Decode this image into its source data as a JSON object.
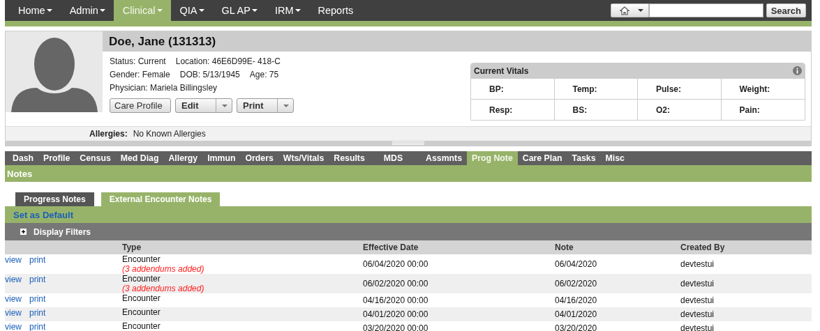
{
  "top_menu": [
    {
      "label": "Home",
      "dropdown": true,
      "selected": false
    },
    {
      "label": "Admin",
      "dropdown": true,
      "selected": false
    },
    {
      "label": "Clinical",
      "dropdown": true,
      "selected": true
    },
    {
      "label": "QIA",
      "dropdown": true,
      "selected": false
    },
    {
      "label": "GL AP",
      "dropdown": true,
      "selected": false
    },
    {
      "label": "IRM",
      "dropdown": true,
      "selected": false
    },
    {
      "label": "Reports",
      "dropdown": false,
      "selected": false
    }
  ],
  "search": {
    "button": "Search"
  },
  "patient": {
    "name": "Doe, Jane (131313)",
    "info_lines": [
      [
        "Status: Current",
        "Location: 46E6D99E- 418-C"
      ],
      [
        "Gender: Female",
        "DOB: 5/13/1945",
        "Age: 75"
      ],
      [
        "Physician: Mariela Billingsley"
      ]
    ],
    "buttons": [
      {
        "label": "Care Profile",
        "dropdown": false
      },
      {
        "label": "Edit",
        "dropdown": true
      },
      {
        "label": "Print",
        "dropdown": true
      }
    ],
    "allergies_label": "Allergies:",
    "allergies": "No Known Allergies"
  },
  "vitals": {
    "title": "Current Vitals",
    "rows": [
      [
        "BP:",
        "Temp:",
        "Pulse:",
        "Weight:"
      ],
      [
        "Resp:",
        "BS:",
        "O2:",
        "Pain:"
      ]
    ]
  },
  "module_tabs": [
    {
      "label": "Dash",
      "selected": false
    },
    {
      "label": "Profile",
      "selected": false
    },
    {
      "label": "Census",
      "selected": false
    },
    {
      "label": "Med Diag",
      "selected": false
    },
    {
      "label": "Allergy",
      "selected": false
    },
    {
      "label": "Immun",
      "selected": false
    },
    {
      "label": "Orders",
      "selected": false
    },
    {
      "label": "Wts/Vitals",
      "selected": false
    },
    {
      "label": "Results",
      "selected": false
    },
    {
      "label": "MDS",
      "selected": false
    },
    {
      "label": "Assmnts",
      "selected": false
    },
    {
      "label": "Prog Note",
      "selected": true
    },
    {
      "label": "Care Plan",
      "selected": false
    },
    {
      "label": "Tasks",
      "selected": false
    },
    {
      "label": "Misc",
      "selected": false
    }
  ],
  "section_title": "Notes",
  "note_tabs": [
    {
      "label": "Progress Notes",
      "selected": false
    },
    {
      "label": "External Encounter Notes",
      "selected": true
    }
  ],
  "set_default": "Set as Default",
  "filters": {
    "label": "Display Filters",
    "expanded": false
  },
  "table": {
    "columns": [
      "Type",
      "Effective Date",
      "Note",
      "Created By"
    ],
    "rows": [
      {
        "actions": [
          "view",
          "print"
        ],
        "type": "Encounter",
        "addendum": "(3 addendums added)",
        "effective_date": "06/04/2020 00:00",
        "note": "06/04/2020",
        "created_by": "devtestui"
      },
      {
        "actions": [
          "view",
          "print"
        ],
        "type": "Encounter",
        "addendum": "(3 addendums added)",
        "effective_date": "06/02/2020 00:00",
        "note": "06/02/2020",
        "created_by": "devtestui"
      },
      {
        "actions": [
          "view",
          "print"
        ],
        "type": "Encounter",
        "effective_date": "04/16/2020 00:00",
        "note": "04/16/2020",
        "created_by": "devtestui"
      },
      {
        "actions": [
          "view",
          "print"
        ],
        "type": "Encounter",
        "effective_date": "04/01/2020 00:00",
        "note": "04/01/2020",
        "created_by": "devtestui"
      },
      {
        "actions": [
          "view",
          "print"
        ],
        "type": "Encounter",
        "effective_date": "03/20/2020 00:00",
        "note": "03/20/2020",
        "created_by": "devtestui"
      }
    ]
  }
}
